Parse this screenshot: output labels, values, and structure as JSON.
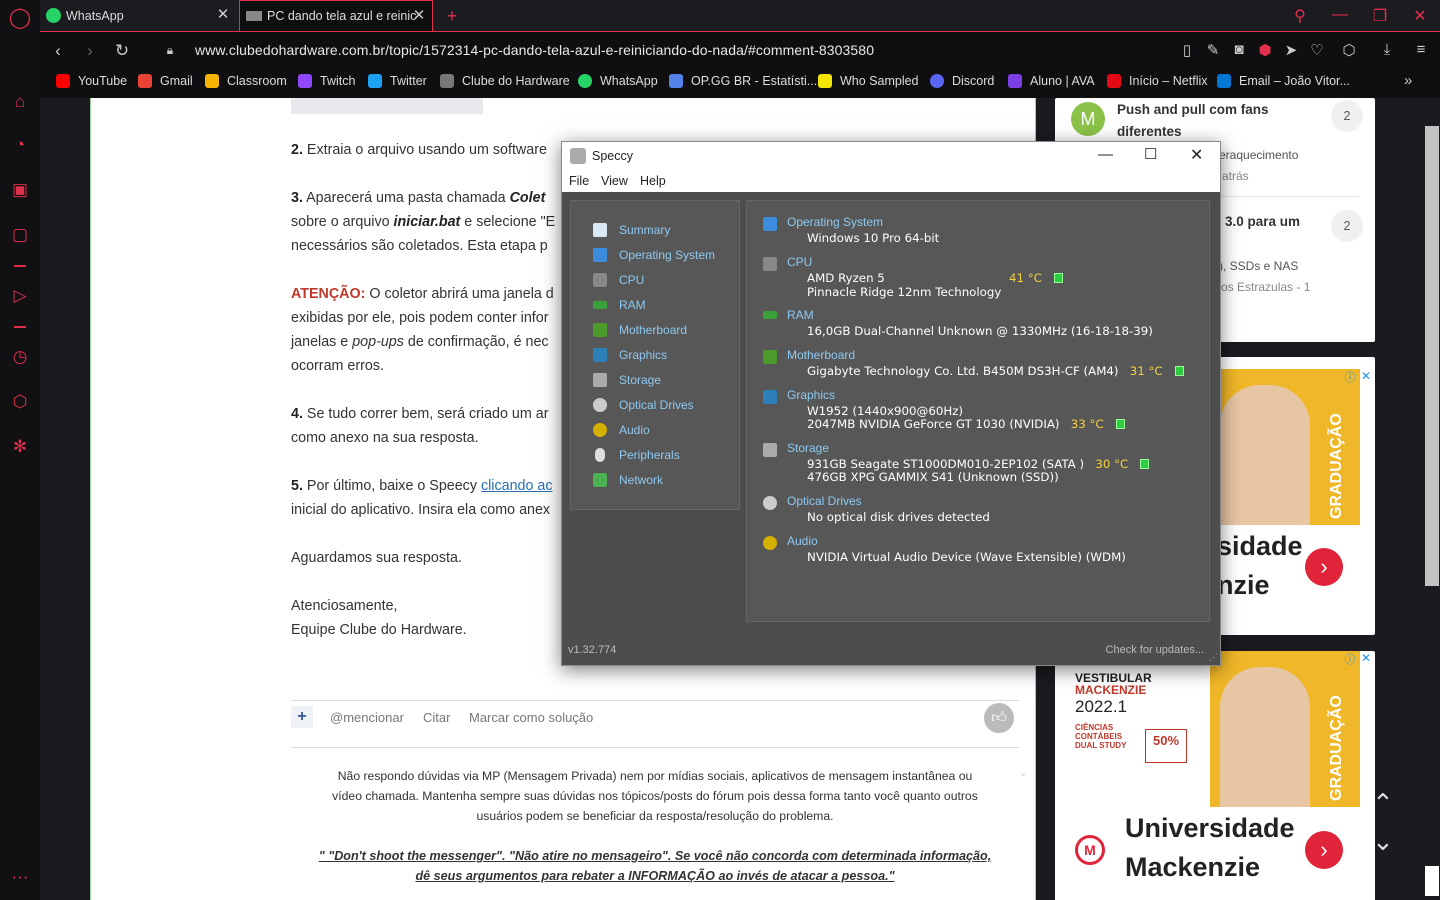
{
  "tabs": [
    {
      "label": "WhatsApp",
      "icon": "whatsapp-icon"
    },
    {
      "label": "PC dando tela azul e reinici...",
      "icon": "cdh-icon"
    }
  ],
  "address": {
    "url": "www.clubedohardware.com.br/topic/1572314-pc-dando-tela-azul-e-reiniciando-do-nada/#comment-8303580"
  },
  "bookmarks": [
    {
      "label": "YouTube",
      "color": "#ff0000"
    },
    {
      "label": "Gmail",
      "color": "#ea4335"
    },
    {
      "label": "Classroom",
      "color": "#f4b400"
    },
    {
      "label": "Twitch",
      "color": "#9146ff"
    },
    {
      "label": "Twitter",
      "color": "#1da1f2"
    },
    {
      "label": "Clube do Hardware",
      "color": "#777777"
    },
    {
      "label": "WhatsApp",
      "color": "#25d366"
    },
    {
      "label": "OP.GG BR - Estatísti...",
      "color": "#5383e8"
    },
    {
      "label": "Who Sampled",
      "color": "#f5e400"
    },
    {
      "label": "Discord",
      "color": "#5865f2"
    },
    {
      "label": "Aluno | AVA",
      "color": "#7b3fe4"
    },
    {
      "label": "Início – Netflix",
      "color": "#e50914"
    },
    {
      "label": "Email – João Vitor...",
      "color": "#0078d4"
    }
  ],
  "post": {
    "step2_num": "2.",
    "step2_text": "Extraia o arquivo usando um software",
    "step3_num": "3.",
    "step3_text_a": "Aparecerá uma pasta chamada",
    "step3_bold": "Colet",
    "step3_line2_a": "sobre o arquivo",
    "step3_line2_bold": "iniciar.bat",
    "step3_line2_b": "e selecione \"E",
    "step3_line3": "necessários são coletados. Esta etapa p",
    "atencao_label": "ATENÇÃO:",
    "atencao_text": "O coletor abrirá uma janela d",
    "atencao_line2": "exibidas por ele, pois podem conter infor",
    "atencao_line3_a": "janelas e",
    "atencao_line3_italic": "pop-ups",
    "atencao_line3_b": "de confirmação, é nec",
    "atencao_line4": "ocorram erros.",
    "step4_num": "4.",
    "step4_text": "Se tudo correr bem, será criado um ar",
    "step4_line2": "como anexo na sua resposta.",
    "step5_num": "5.",
    "step5_text": "Por último, baixe o Speecy",
    "step5_link": "clicando ac",
    "step5_line2": "inicial do aplicativo. Insira ela como anex",
    "aguardamos": "Aguardamos sua resposta.",
    "atenciosamente": "Atenciosamente,",
    "equipe": "Equipe Clube do Hardware."
  },
  "actions": {
    "plus": "+",
    "mention": "@mencionar",
    "quote": "Citar",
    "solution": "Marcar como solução"
  },
  "signature": {
    "line1": "Não respondo dúvidas via MP (Mensagem Privada) nem por mídias sociais, aplicativos de mensagem instantânea ou",
    "line2": "vídeo chamada. Mantenha sempre suas dúvidas nos tópicos/posts do fórum pois dessa forma tanto você quanto outros",
    "line3": "usuários podem se beneficiar da resposta/resolução do problema.",
    "line4": "\" \"Don't shoot the messenger\". \"Não atire no mensageiro\". Se você não concorda com determinada informação,",
    "line5": "dê seus argumentos para rebater a INFORMAÇÃO ao invés de atacar a pessoa.\""
  },
  "sidebar_topics": [
    {
      "title_line1": "Push and pull com fans",
      "title_line2": "diferentes",
      "meta": "eraquecimento",
      "meta2": "atrás",
      "count": "2",
      "avatar": "M"
    },
    {
      "title_line1": "3.0 para um",
      "meta": "), SSDs e NAS",
      "meta2": "os Estrazulas - 1",
      "count": "2"
    }
  ],
  "ads": {
    "ad1_headline_a": "sidade",
    "ad1_headline_b": "nzie",
    "ad1_vertical": "GRADUAÇÃO",
    "ad2_title": "VESTIBULAR",
    "ad2_title2": "MACKENZIE",
    "ad2_year": "2022.1",
    "ad2_course1": "CIÊNCIAS",
    "ad2_course2": "CONTÁBEIS",
    "ad2_course3": "DUAL STUDY",
    "ad2_discount": "50%",
    "ad2_vertical": "GRADUAÇÃO",
    "ad2_headline_a": "Universidade",
    "ad2_headline_b": "Mackenzie"
  },
  "speccy": {
    "title": "Speccy",
    "menu": [
      "File",
      "View",
      "Help"
    ],
    "nav": [
      {
        "label": "Summary",
        "color": "#d9e8f5"
      },
      {
        "label": "Operating System",
        "color": "#3c8dde"
      },
      {
        "label": "CPU",
        "color": "#888888"
      },
      {
        "label": "RAM",
        "color": "#3aa03a"
      },
      {
        "label": "Motherboard",
        "color": "#4c9a2a"
      },
      {
        "label": "Graphics",
        "color": "#2d7fb8"
      },
      {
        "label": "Storage",
        "color": "#aaaaaa"
      },
      {
        "label": "Optical Drives",
        "color": "#cccccc"
      },
      {
        "label": "Audio",
        "color": "#d4b000"
      },
      {
        "label": "Peripherals",
        "color": "#dddddd"
      },
      {
        "label": "Network",
        "color": "#4caf50"
      }
    ],
    "sections": {
      "os_head": "Operating System",
      "os_val": "Windows 10 Pro 64-bit",
      "cpu_head": "CPU",
      "cpu_val1": "AMD Ryzen 5",
      "cpu_temp": "41 °C",
      "cpu_val2": "Pinnacle Ridge 12nm Technology",
      "ram_head": "RAM",
      "ram_val": "16,0GB Dual-Channel Unknown @ 1330MHz (16-18-18-39)",
      "mb_head": "Motherboard",
      "mb_val": "Gigabyte Technology Co. Ltd. B450M DS3H-CF (AM4)",
      "mb_temp": "31 °C",
      "gfx_head": "Graphics",
      "gfx_val1": "W1952 (1440x900@60Hz)",
      "gfx_val2": "2047MB NVIDIA GeForce GT 1030 (NVIDIA)",
      "gfx_temp": "33 °C",
      "sto_head": "Storage",
      "sto_val1": "931GB Seagate ST1000DM010-2EP102 (SATA )",
      "sto_temp": "30 °C",
      "sto_val2": "476GB XPG GAMMIX S41 (Unknown (SSD))",
      "opt_head": "Optical Drives",
      "opt_val": "No optical disk drives detected",
      "aud_head": "Audio",
      "aud_val": "NVIDIA Virtual Audio Device (Wave Extensible) (WDM)"
    },
    "version": "v1.32.774",
    "update": "Check for updates..."
  }
}
